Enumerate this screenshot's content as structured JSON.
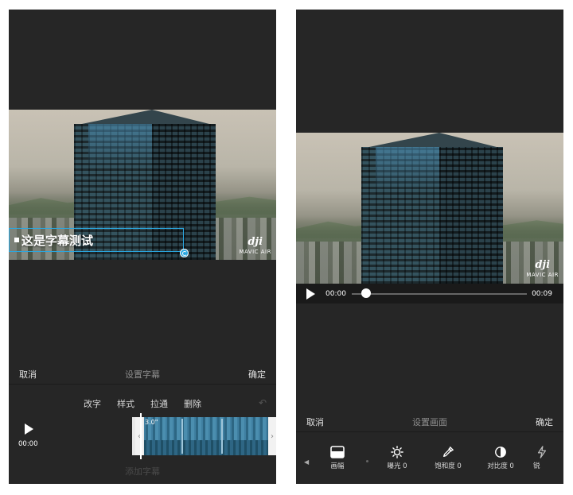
{
  "left": {
    "subtitle_text": "这是字幕测试",
    "watermark": {
      "logo": "dji",
      "model": "MAVIC AIR"
    },
    "bar": {
      "cancel": "取消",
      "title": "设置字幕",
      "confirm": "确定"
    },
    "tools": [
      "改字",
      "样式",
      "拉通",
      "删除"
    ],
    "undo": "↶",
    "time": "00:00",
    "clip_duration": "3.0\"",
    "add_subtitle": "添加字幕"
  },
  "right": {
    "watermark": {
      "logo": "dji",
      "model": "MAVIC AIR"
    },
    "player": {
      "current": "00:00",
      "total": "00:09",
      "progress": 0.08
    },
    "bar": {
      "cancel": "取消",
      "title": "设置画面",
      "confirm": "确定"
    },
    "adjust_items": [
      {
        "label": "画幅",
        "icon": "frame-ratio-icon"
      },
      {
        "label": "曝光 0",
        "icon": "sun-icon"
      },
      {
        "label": "饱和度 0",
        "icon": "eyedropper-icon"
      },
      {
        "label": "对比度 0",
        "icon": "contrast-icon"
      },
      {
        "label": "锐",
        "icon": "sharpen-icon"
      }
    ]
  },
  "colors": {
    "accent": "#2aa7e0",
    "panel": "#262626",
    "video_bg": "#1e1e1e"
  }
}
